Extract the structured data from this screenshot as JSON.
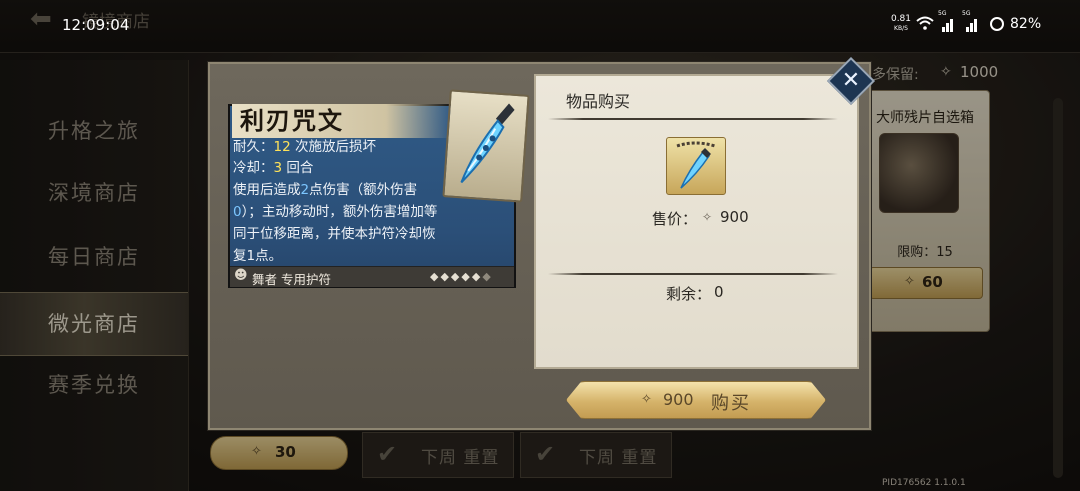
{
  "status_bar": {
    "time": "12:09:04",
    "net_speed_value": "0.81",
    "net_speed_unit": "KB/S",
    "sig_label_1": "5G",
    "sig_label_2": "5G",
    "battery": "82%"
  },
  "background": {
    "title": "镜境商店",
    "keep_label": "多保留:",
    "keep_value": "1000",
    "sidebar_items": [
      {
        "label": "升格之旅"
      },
      {
        "label": "深境商店"
      },
      {
        "label": "每日商店"
      },
      {
        "label": "微光商店"
      },
      {
        "label": "赛季兑换"
      }
    ],
    "active_index": 3,
    "shop_card": {
      "title": "大师残片自选箱",
      "limit": "限购：15",
      "price": "60"
    },
    "bottom_price": "30",
    "reset_buttons": [
      {
        "label": "下周 重置"
      },
      {
        "label": "下周 重置"
      }
    ],
    "pid": "PID176562  1.1.0.1"
  },
  "item": {
    "name": "利刃咒文",
    "durability_prefix": "耐久：",
    "durability_value": "12",
    "durability_suffix": " 次施放后损坏",
    "cooldown_prefix": "冷却：",
    "cooldown_value": "3",
    "cooldown_suffix": " 回合",
    "desc1_a": "使用后造成",
    "desc1_b": "2",
    "desc1_c": "点伤害（额外伤害",
    "desc2_a": "0",
    "desc2_b": "）；主动移动时，额外伤害增加等",
    "desc3": "同于位移距离，并使本护符冷却恢",
    "desc4": "复1点。",
    "class_label": "舞者 专用护符"
  },
  "purchase": {
    "title": "物品购买",
    "price_label": "售价：",
    "price_value": "900",
    "remain_label": "剩余：",
    "remain_value": "0",
    "buy_price": "900",
    "buy_label": "购买"
  },
  "colors": {
    "accent_gold": "#d5b36a",
    "item_card_blue": "#2f5a86",
    "highlight_yellow": "#ffe259",
    "highlight_blue": "#7cc6ff",
    "close_button": "#1d3552"
  },
  "icons": {
    "back": "arrow-left-icon",
    "currency": "gleam-shard-icon",
    "close": "close-icon",
    "reset": "check-icon"
  }
}
